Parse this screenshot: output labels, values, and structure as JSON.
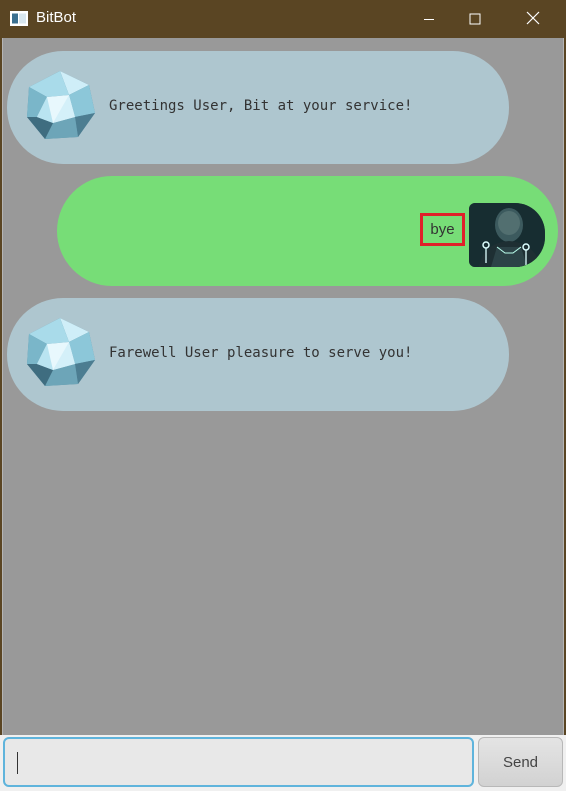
{
  "window": {
    "title": "BitBot",
    "icon": "app-window-icon",
    "controls": [
      "minimize-icon",
      "maximize-icon",
      "close-icon"
    ]
  },
  "chat": {
    "messages": [
      {
        "sender": "bot",
        "avatar": "crystal-icosahedron-avatar",
        "text": "Greetings User, Bit at your service!"
      },
      {
        "sender": "user",
        "avatar": "user-photo-avatar",
        "text": "bye"
      },
      {
        "sender": "bot",
        "avatar": "crystal-icosahedron-avatar",
        "text": "Farewell User pleasure to serve you!"
      }
    ]
  },
  "input": {
    "value": "",
    "send_label": "Send"
  },
  "colors": {
    "titlebar": "#5a4523",
    "chat_background": "#999999",
    "bot_bubble": "#aec6cf",
    "user_bubble": "#77dd77",
    "highlight_border": "#e0202a",
    "input_focus_border": "#5fb4dc"
  }
}
